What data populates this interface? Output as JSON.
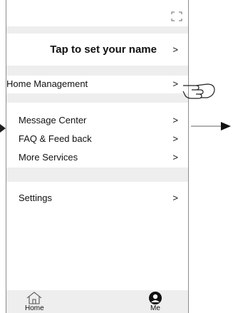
{
  "profile": {
    "name_prompt": "Tap to set your name",
    "chevron": ">"
  },
  "menu": {
    "home_management": "Home Management",
    "message_center": "Message Center",
    "faq_feedback": "FAQ & Feed back",
    "more_services": "More Services",
    "settings": "Settings",
    "chevron": ">"
  },
  "tabbar": {
    "home_label": "Home",
    "me_label": "Me"
  },
  "icons": {
    "scan": "scan-icon",
    "home": "home-icon",
    "me": "avatar-icon",
    "hand": "hand-pointer-icon"
  },
  "colors": {
    "band": "#eeeeee",
    "frame": "#8c8c8c",
    "text": "#111111"
  }
}
